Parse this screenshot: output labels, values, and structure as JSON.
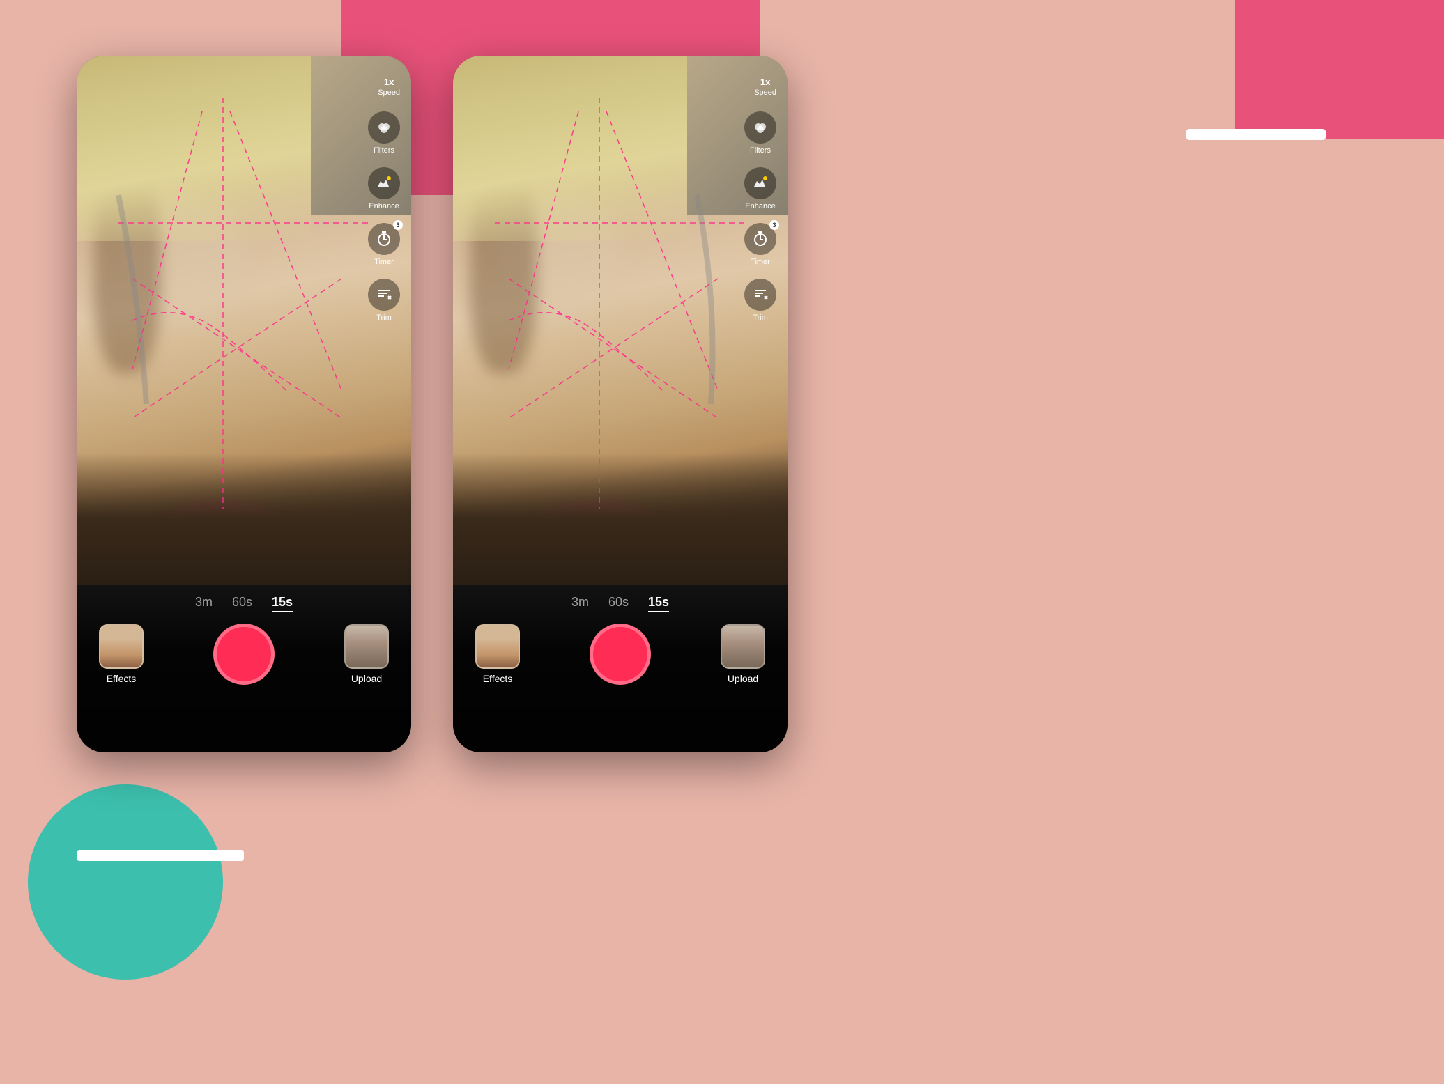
{
  "background": {
    "color": "#e8b4a8"
  },
  "decorative": {
    "pink_rect_label": "decorative-pink-background",
    "teal_circle_label": "decorative-teal-circle",
    "white_bar_label": "decorative-white-bar"
  },
  "phones": [
    {
      "id": "phone-left",
      "speed": {
        "value": "1x",
        "label": "Speed"
      },
      "right_icons": [
        {
          "icon": "●●",
          "label": "Filters",
          "name": "filters-icon"
        },
        {
          "icon": "✦",
          "label": "Enhance",
          "name": "enhance-icon"
        },
        {
          "icon": "⏱",
          "label": "Timer",
          "name": "timer-icon",
          "badge": "3"
        },
        {
          "icon": "♪✕",
          "label": "Trim",
          "name": "trim-icon"
        }
      ],
      "duration_options": [
        {
          "label": "3m",
          "active": false
        },
        {
          "label": "60s",
          "active": false
        },
        {
          "label": "15s",
          "active": true
        }
      ],
      "effects": {
        "label": "Effects"
      },
      "upload": {
        "label": "Upload"
      }
    },
    {
      "id": "phone-right",
      "speed": {
        "value": "1x",
        "label": "Speed"
      },
      "right_icons": [
        {
          "icon": "●●",
          "label": "Filters",
          "name": "filters-icon"
        },
        {
          "icon": "✦",
          "label": "Enhance",
          "name": "enhance-icon"
        },
        {
          "icon": "⏱",
          "label": "Timer",
          "name": "timer-icon",
          "badge": "3"
        },
        {
          "icon": "♪✕",
          "label": "Trim",
          "name": "trim-icon"
        }
      ],
      "duration_options": [
        {
          "label": "3m",
          "active": false
        },
        {
          "label": "60s",
          "active": false
        },
        {
          "label": "15s",
          "active": true
        }
      ],
      "effects": {
        "label": "Effects"
      },
      "upload": {
        "label": "Upload"
      }
    }
  ]
}
